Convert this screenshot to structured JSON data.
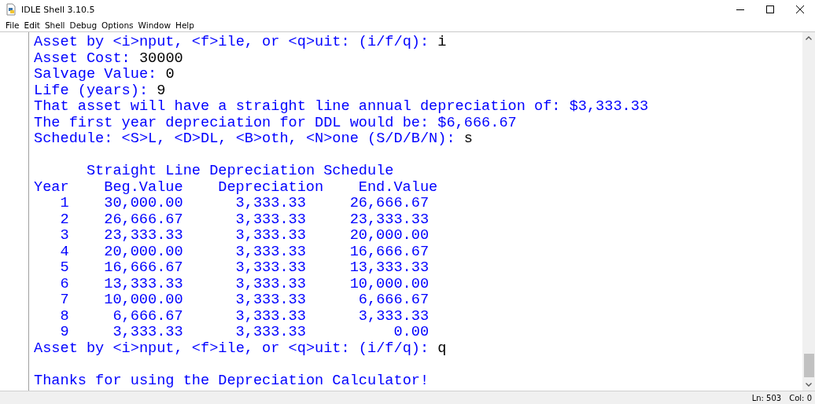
{
  "window": {
    "title": "IDLE Shell 3.10.5"
  },
  "menu": [
    "File",
    "Edit",
    "Shell",
    "Debug",
    "Options",
    "Window",
    "Help"
  ],
  "lines_before": [
    {
      "prompt": "Asset by <i>nput, <f>ile, or <q>uit: (i/f/q): ",
      "input": "i"
    },
    {
      "prompt": "Asset Cost: ",
      "input": "30000"
    },
    {
      "prompt": "Salvage Value: ",
      "input": "0"
    },
    {
      "prompt": "Life (years): ",
      "input": "9"
    },
    {
      "prompt": "That asset will have a straight line annual depreciation of: $3,333.33"
    },
    {
      "prompt": "The first year depreciation for DDL would be: $6,666.67"
    },
    {
      "prompt": "Schedule: <S>L, <D>DL, <B>oth, <N>one (S/D/B/N): ",
      "input": "s"
    }
  ],
  "schedule": {
    "title": "Straight Line Depreciation Schedule",
    "columns": [
      "Year",
      "Beg.Value",
      "Depreciation",
      "End.Value"
    ],
    "rows": [
      [
        "1",
        "30,000.00",
        "3,333.33",
        "26,666.67"
      ],
      [
        "2",
        "26,666.67",
        "3,333.33",
        "23,333.33"
      ],
      [
        "3",
        "23,333.33",
        "3,333.33",
        "20,000.00"
      ],
      [
        "4",
        "20,000.00",
        "3,333.33",
        "16,666.67"
      ],
      [
        "5",
        "16,666.67",
        "3,333.33",
        "13,333.33"
      ],
      [
        "6",
        "13,333.33",
        "3,333.33",
        "10,000.00"
      ],
      [
        "7",
        "10,000.00",
        "3,333.33",
        "6,666.67"
      ],
      [
        "8",
        "6,666.67",
        "3,333.33",
        "3,333.33"
      ],
      [
        "9",
        "3,333.33",
        "3,333.33",
        "0.00"
      ]
    ]
  },
  "lines_after": [
    {
      "prompt": "Asset by <i>nput, <f>ile, or <q>uit: (i/f/q): ",
      "input": "q"
    }
  ],
  "closing_lines": [
    {
      "prompt": "Thanks for using the Depreciation Calculator!"
    }
  ],
  "status_bar": {
    "line": "Ln: 503",
    "column": "Col: 0"
  }
}
